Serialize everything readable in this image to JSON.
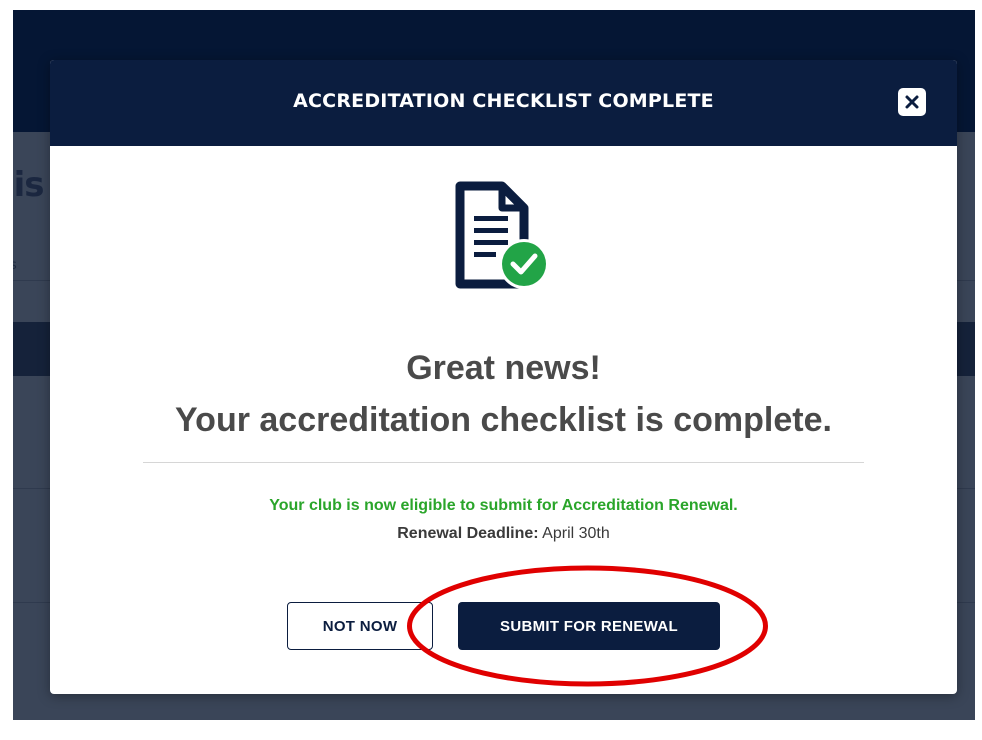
{
  "modal": {
    "title": "ACCREDITATION CHECKLIST COMPLETE",
    "close_icon": "close-icon",
    "status_icon": "document-check-icon",
    "headline_line1": "Great news!",
    "headline_line2": "Your accreditation checklist is complete.",
    "eligible_text": "Your club is now eligible to submit for Accreditation Renewal.",
    "deadline_label": "Renewal Deadline:",
    "deadline_value": "April 30th",
    "not_now_label": "NOT NOW",
    "submit_label": "SUBMIT FOR RENEWAL"
  },
  "background": {
    "title_fragment": "lis",
    "sub_fragment": "s"
  },
  "colors": {
    "navy": "#0b1d3f",
    "success_green": "#2aa52a",
    "annotation_red": "#e00000"
  }
}
